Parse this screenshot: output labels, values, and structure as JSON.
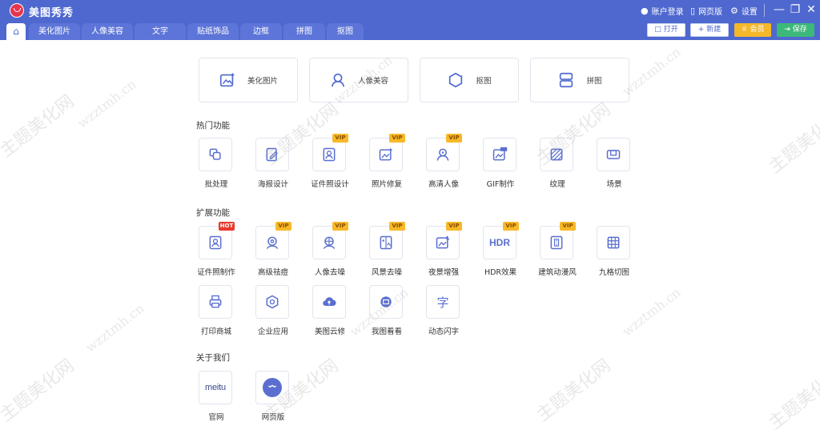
{
  "app": {
    "title": "美图秀秀"
  },
  "titlebar": {
    "login": "账户登录",
    "web": "网页版",
    "settings": "设置"
  },
  "tabs": [
    "美化图片",
    "人像美容",
    "文字",
    "贴纸饰品",
    "边框",
    "拼图",
    "抠图"
  ],
  "header_buttons": {
    "open": "打开",
    "new": "新建",
    "vip": "会员",
    "save": "保存"
  },
  "main_cards": [
    {
      "label": "美化图片",
      "icon": "image-magic-icon"
    },
    {
      "label": "人像美容",
      "icon": "portrait-icon"
    },
    {
      "label": "抠图",
      "icon": "cutout-icon"
    },
    {
      "label": "拼图",
      "icon": "collage-icon"
    }
  ],
  "sections": {
    "hot": "热门功能",
    "ext": "扩展功能",
    "about": "关于我们"
  },
  "hot_tools": [
    {
      "label": "批处理",
      "icon": "batch-icon",
      "badge": ""
    },
    {
      "label": "海报设计",
      "icon": "poster-icon",
      "badge": ""
    },
    {
      "label": "证件照设计",
      "icon": "id-photo-icon",
      "badge": "VIP"
    },
    {
      "label": "照片修复",
      "icon": "photo-repair-icon",
      "badge": "VIP"
    },
    {
      "label": "高清人像",
      "icon": "hd-portrait-icon",
      "badge": "VIP"
    },
    {
      "label": "GIF制作",
      "icon": "gif-icon",
      "badge": ""
    },
    {
      "label": "纹理",
      "icon": "texture-icon",
      "badge": ""
    },
    {
      "label": "场景",
      "icon": "scene-icon",
      "badge": ""
    }
  ],
  "ext_tools_row1": [
    {
      "label": "证件照制作",
      "icon": "id-photo-make-icon",
      "badge": "HOT"
    },
    {
      "label": "高级祛痘",
      "icon": "acne-icon",
      "badge": "VIP"
    },
    {
      "label": "人像去噪",
      "icon": "portrait-denoise-icon",
      "badge": "VIP"
    },
    {
      "label": "风景去噪",
      "icon": "landscape-denoise-icon",
      "badge": "VIP"
    },
    {
      "label": "夜景增强",
      "icon": "night-enhance-icon",
      "badge": "VIP"
    },
    {
      "label": "HDR效果",
      "icon": "hdr-icon",
      "badge": "VIP",
      "glyph": "HDR"
    },
    {
      "label": "建筑动漫风",
      "icon": "architecture-anime-icon",
      "badge": "VIP"
    },
    {
      "label": "九格切图",
      "icon": "nine-grid-icon",
      "badge": ""
    }
  ],
  "ext_tools_row2": [
    {
      "label": "打印商城",
      "icon": "print-icon",
      "badge": ""
    },
    {
      "label": "企业应用",
      "icon": "enterprise-icon",
      "badge": ""
    },
    {
      "label": "美图云修",
      "icon": "cloud-retouch-icon",
      "badge": ""
    },
    {
      "label": "我图看看",
      "icon": "image-view-icon",
      "badge": ""
    },
    {
      "label": "动态闪字",
      "icon": "flash-text-icon",
      "badge": "",
      "glyph": "字"
    }
  ],
  "about_tools": [
    {
      "label": "官网",
      "icon": "meitu-logo-icon",
      "glyph": "meitu"
    },
    {
      "label": "网页版",
      "icon": "web-version-icon"
    }
  ],
  "watermark": {
    "text1": "主题美化网",
    "text2": "wzztmh.cn"
  },
  "colors": {
    "primary": "#4f68cf",
    "vip": "#f4b82a",
    "save": "#3cb878",
    "hot": "#e83a2c"
  }
}
